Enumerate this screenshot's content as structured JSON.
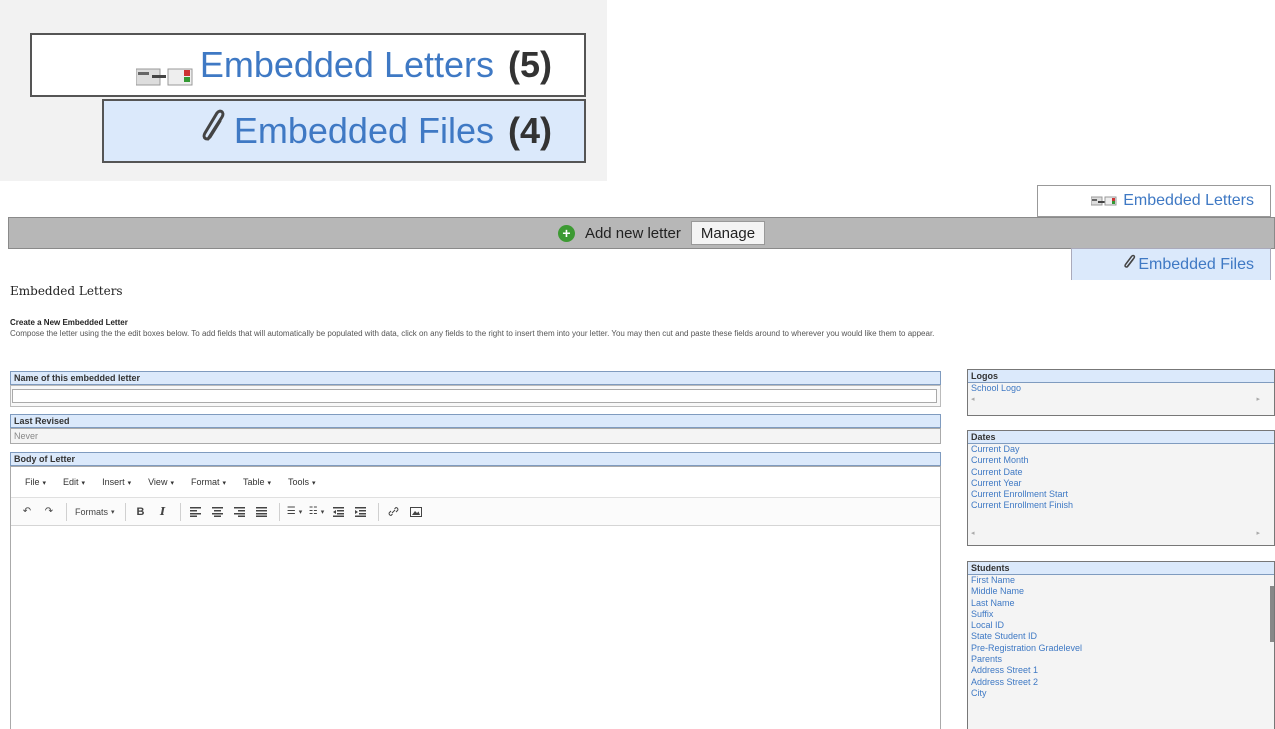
{
  "zoom": {
    "letters_label": "Embedded Letters",
    "letters_count": "(5)",
    "files_label": "Embedded Files",
    "files_count": "(4)"
  },
  "side_tabs": {
    "letters": "Embedded Letters",
    "files": "Embedded Files"
  },
  "action_bar": {
    "add_label": "Add new letter",
    "manage_label": "Manage"
  },
  "page": {
    "title": "Embedded Letters",
    "section_title": "Create a New Embedded Letter",
    "description": "Compose the letter using the the edit boxes below. To add fields that will automatically be populated with data, click on any fields to the right to insert them into your letter. You may then cut and paste these fields around to wherever you would like them to appear."
  },
  "form": {
    "name_label": "Name of this embedded letter",
    "name_value": "",
    "revised_label": "Last Revised",
    "revised_value": "Never",
    "body_label": "Body of Letter"
  },
  "editor": {
    "menus": [
      "File",
      "Edit",
      "Insert",
      "View",
      "Format",
      "Table",
      "Tools"
    ],
    "formats_label": "Formats"
  },
  "panels": {
    "logos": {
      "title": "Logos",
      "items": [
        "School Logo"
      ]
    },
    "dates": {
      "title": "Dates",
      "items": [
        "Current Day",
        "Current Month",
        "Current Date",
        "Current Year",
        "Current Enrollment Start",
        "Current Enrollment Finish"
      ]
    },
    "students": {
      "title": "Students",
      "items": [
        "First Name",
        "Middle Name",
        "Last Name",
        "Suffix",
        "Local ID",
        "State Student ID",
        "Pre-Registration Gradelevel",
        "Parents",
        "Address Street 1",
        "Address Street 2",
        "City"
      ]
    }
  },
  "colors": {
    "link_blue": "#3f79c4",
    "header_blue": "#dbe9fb",
    "action_bar_gray": "#b7b7b7",
    "add_icon_green": "#3d9a33"
  },
  "icons": {
    "letter": "letter-icon",
    "attachment": "paperclip-icon",
    "add": "plus-circle-icon"
  }
}
